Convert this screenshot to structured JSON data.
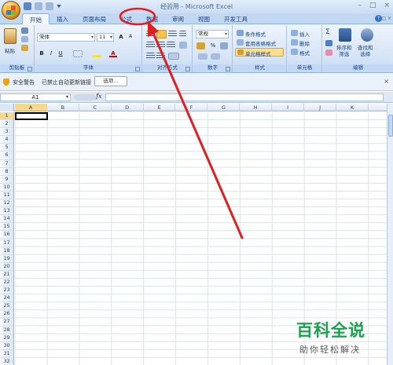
{
  "window": {
    "title": "经验用 - Microsoft Excel",
    "controls": [
      "–",
      "□",
      "×"
    ]
  },
  "tabs": [
    "开始",
    "插入",
    "页面布局",
    "公式",
    "数据",
    "审阅",
    "视图",
    "开发工具"
  ],
  "active_tab": "开始",
  "ribbon": {
    "clipboard": {
      "label": "剪贴板",
      "paste": "粘贴"
    },
    "font": {
      "label": "字体",
      "font_name": "宋体",
      "font_size": "11",
      "bold": "B",
      "italic": "I",
      "underline": "U",
      "grow": "A",
      "shrink": "A",
      "font_color": "A"
    },
    "alignment": {
      "label": "对齐方式"
    },
    "number": {
      "label": "数字",
      "format": "常规",
      "percent": "%"
    },
    "styles": {
      "label": "样式",
      "conditional": "条件格式",
      "table": "套用表格格式",
      "cell_styles": "单元格样式"
    },
    "cells": {
      "label": "单元格",
      "insert": "插入",
      "delete": "删除",
      "format": "格式"
    },
    "editing": {
      "label": "编辑",
      "sort": "排序和\n筛选",
      "find": "查找和\n选择"
    }
  },
  "security_bar": {
    "title": "安全警告",
    "message": "已禁止自动更新链接",
    "options_button": "选项..."
  },
  "formula_bar": {
    "name_box": "A1",
    "fx": "fx",
    "value": ""
  },
  "grid": {
    "columns": [
      "A",
      "B",
      "C",
      "D",
      "E",
      "F",
      "G",
      "H",
      "I",
      "J",
      "K"
    ],
    "rows": [
      "1",
      "2",
      "3",
      "4",
      "5",
      "6",
      "7",
      "8",
      "9",
      "10",
      "11",
      "12",
      "13",
      "14",
      "15",
      "16",
      "17",
      "18",
      "19",
      "20",
      "21",
      "22",
      "23",
      "24",
      "25",
      "26",
      "27",
      "28",
      "29",
      "30",
      "31",
      "32"
    ],
    "active_cell": "A1"
  },
  "annotation": {
    "color": "#e02020",
    "target": "数据"
  },
  "watermark": {
    "main": "百科全说",
    "sub": "助你轻松解决"
  }
}
